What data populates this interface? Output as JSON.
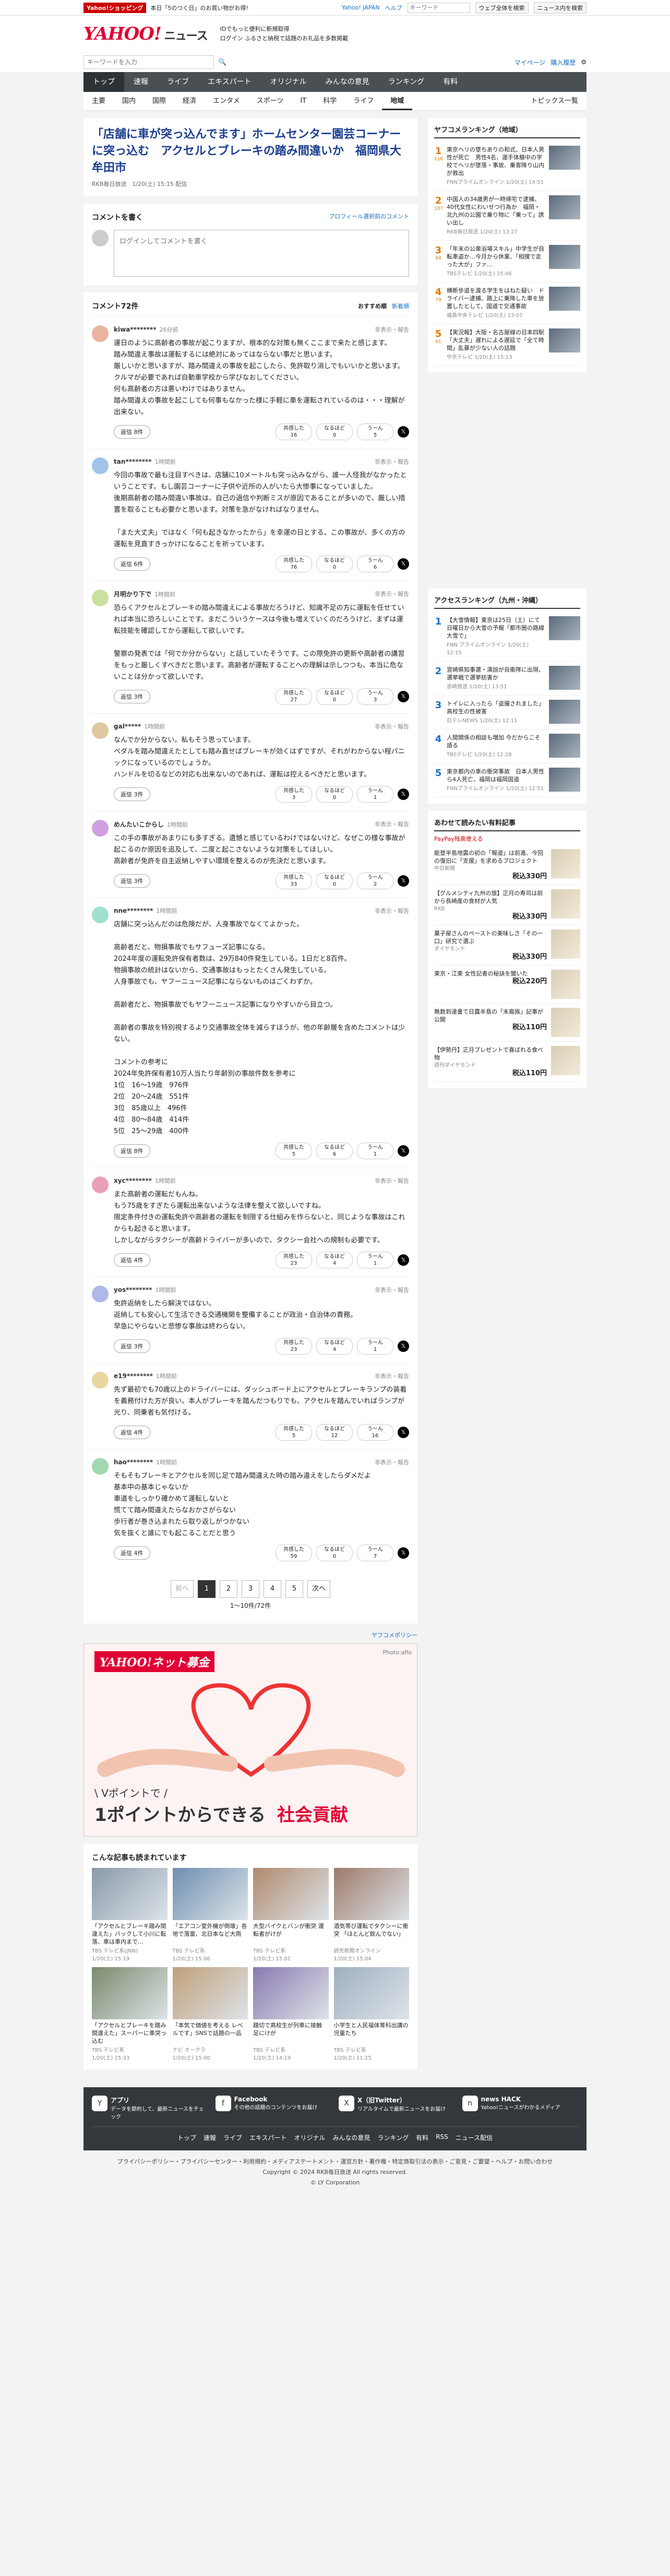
{
  "promo": {
    "tag": "Yahoo!ショッピング",
    "text": "本日「5のつく日」のお買い物がお得!",
    "link1": "Yahoo! JAPAN",
    "link2": "ヘルプ",
    "search_placeholder": "キーワード",
    "search_btn": "ウェブ全体を検索",
    "search_btn2": "ニュース内を検索"
  },
  "masthead": {
    "logo": "YAHOO!",
    "logo_sub": "ニュース",
    "msg1": "IDでもっと便利に新規取得",
    "msg2": "ログイン ふるさと納税で話題のお礼品を多数掲載"
  },
  "search": {
    "placeholder": "キーワードを入力",
    "mypage": "マイページ",
    "purchase": "購入履歴",
    "settings_icon": "gear-icon"
  },
  "nav_main": [
    "トップ",
    "速報",
    "ライブ",
    "エキスパート",
    "オリジナル",
    "みんなの意見",
    "ランキング",
    "有料"
  ],
  "nav_main_active": 0,
  "nav_sub": [
    "主要",
    "国内",
    "国際",
    "経済",
    "エンタメ",
    "スポーツ",
    "IT",
    "科学",
    "ライフ",
    "地域"
  ],
  "nav_sub_active": 9,
  "nav_sub_right": "トピックス一覧",
  "article": {
    "title": "「店舗に車が突っ込んでます」ホームセンター園芸コーナーに突っ込む　アクセルとブレーキの踏み間違いか　福岡県大牟田市",
    "source": "RKB毎日放送",
    "date": "1/20(土) 15:15 配信"
  },
  "write": {
    "title": "コメントを書く",
    "profile_link": "プロフィール選択前のコメント",
    "placeholder": "ログインしてコメントを書く"
  },
  "comments_head": {
    "title": "コメント72件",
    "sort1": "おすすめ順",
    "sort2": "新着順"
  },
  "react_labels": {
    "agree": "共感した",
    "think": "なるほど",
    "disagree": "うーん"
  },
  "comments": [
    {
      "user": "kiwa********",
      "time": "26分前",
      "report": "非表示・報告",
      "text": "運日のように高齢者の事故が起こりますが、根本的な対策も無くここまで来たと感じます。\n踏み間違え事故は運転するには絶対にあってはならない事だと思います。\n厳しいかと思いますが、踏み間違えの事故を起こしたら、免許取り消しでもいいかと思います。\nクルマが必要であれば自動車学校から学びなおしてください。\n何も高齢者の方は悪いわけではありません。\n踏み間違えの事故を起こしても何事もなかった様に手軽に車を運転されているのは・・・理解が出来ない。",
      "reply": "返信 8件",
      "agree": "16",
      "think": "0",
      "disagree": "5"
    },
    {
      "user": "tan********",
      "time": "1時間前",
      "report": "非表示・報告",
      "text": "今回の事故で最も注目すべきは、店舗に10メートルも突っ込みながら、誰一人怪我がなかったということです。もし園芸コーナーに子供や近所の人がいたら大惨事になっていました。\n後期高齢者の踏み間違い事故は、自己の過信や判断ミスが原因であることが多いので、厳しい措置を取ることも必要かと思います。対策を急がなければなりません。\n\n「また大丈夫」ではなく「何も起きなかったから」を幸運の日とする。この事故が、多くの方の運転を見直すきっかけになることを祈っています。",
      "reply": "返信 6件",
      "agree": "76",
      "think": "0",
      "disagree": "6"
    },
    {
      "user": "月明かり下で",
      "time": "1時間前",
      "report": "非表示・報告",
      "text": "恐らくアクセルとブレーキの踏み間違えによる事故だろうけど、知識不足の方に運転を任せていれば本当に恐ろしいことです。まだこういうケースは今後も増えていくのだろうけど、まずは運転技能を確認してから運転して欲しいです。\n\n警察の発表では「何でか分からない」と話していたそうです。この際免許の更新や高齢者の講習をもっと厳しくすべきだと思います。高齢者が運転することへの理解は示しつつも、本当に危ないことは分かって欲しいです。",
      "reply": "返信 3件",
      "agree": "27",
      "think": "0",
      "disagree": "3"
    },
    {
      "user": "gal*****",
      "time": "1時間前",
      "report": "非表示・報告",
      "text": "なんでか分からない。私もそう思っています。\nペダルを踏み間違えたとしても踏み直せばブレーキが効くはずですが、それがわからない程パニックになっているのでしょうか。\nハンドルを切るなどの対応も出来ないのであれば、運転は控えるべきだと思います。",
      "reply": "返信 3件",
      "agree": "3",
      "think": "0",
      "disagree": "1"
    },
    {
      "user": "めんたいこからし",
      "time": "1時間前",
      "report": "非表示・報告",
      "text": "この手の事故があまりにも多すぎる。遺憾と感じているわけではないけど、なぜこの様な事故が起こるのか原因を追及して、二度と起こさないような対策をしてほしい。\n高齢者が免許を自主返納しやすい環境を整えるのが先決だと思います。",
      "reply": "返信 3件",
      "agree": "33",
      "think": "0",
      "disagree": "2"
    },
    {
      "user": "nne********",
      "time": "1時間前",
      "report": "非表示・報告",
      "text": "店舗に突っ込んだのは危険だが、人身事故でなくてよかった。\n\n高齢者だと、物損事故でもサフューズ記事になる。\n2024年度の運転免許保有者数は、29万840件発生している。1日だと8百件。\n物損事故の統計はないから、交通事故はもっとたくさん発生している。\n人身事故でも、ヤフーニュース記事にならないものはごくわずか。\n\n高齢者だと、物損事故でもヤフーニュース記事になりやすいから目立つ。\n\n高齢者の事故を特別視するより交通事故全体を減らすほうが、他の年齢層を含めたコメントは少ない。\n\nコメントの参考に\n2024年免許保有者10万人当たり年齢別の事故件数を参考に\n1位　16〜19歳　976件\n2位　20〜24歳　551件\n3位　85歳以上　496件\n4位　80〜84歳　414件\n5位　25〜29歳　400件",
      "reply": "返信 8件",
      "agree": "5",
      "think": "6",
      "disagree": "1"
    },
    {
      "user": "xyc********",
      "time": "1時間前",
      "report": "非表示・報告",
      "text": "また高齢者の運転だもんね。\nもう75歳をすぎたら運転出来ないような法律を整えて欲しいですね。\n限定条件付きの運転免許や高齢者の運転を制限する仕組みを作らないと、同じような事故はこれからも起きると思います。\nしかしながらタクシーが高齢ドライバーが多いので、タクシー会社への規制も必要です。",
      "reply": "返信 4件",
      "agree": "23",
      "think": "4",
      "disagree": "1"
    },
    {
      "user": "yos********",
      "time": "1時間前",
      "report": "非表示・報告",
      "text": "免許返納をしたら解決ではない。\n返納しても安心して生活できる交通機関を整備することが政治・自治体の責務。\n早急にやらないと悲惨な事故は終わらない。",
      "reply": "返信 3件",
      "agree": "23",
      "think": "4",
      "disagree": "1"
    },
    {
      "user": "e19********",
      "time": "1時間前",
      "report": "非表示・報告",
      "text": "先ず最初でも70歳以上のドライバーには、ダッシュボード上にアクセルとブレーキランプの装着を義務付けた方が良い。本人がブレーキを踏んだつもりでも、アクセルを踏んでいればランプが光り、同乗者も気付ける。",
      "reply": "返信 4件",
      "agree": "5",
      "think": "12",
      "disagree": "16"
    },
    {
      "user": "hao********",
      "time": "1時間前",
      "report": "非表示・報告",
      "text": "そもそもブレーキとアクセルを同じ足で踏み間違えた時の踏み違えをしたらダメだよ\n基本中の基本じゃないか\n車道をしっかり確かめて運転しないと\n慌てて踏み間違えたらなおかさがらない\n歩行者が巻き込まれたら取り返しがつかない\n気を抜くと誰にでも起こることだと思う",
      "reply": "返信 4件",
      "agree": "59",
      "think": "0",
      "disagree": "7"
    }
  ],
  "pager": {
    "prev": "前へ",
    "pages": [
      "1",
      "2",
      "3",
      "4",
      "5"
    ],
    "current": 0,
    "next": "次へ",
    "info": "1〜10件/72件"
  },
  "ad": {
    "link": "ヤフコメポリシー",
    "logo": "YAHOO!ネット募金",
    "corner": "Photo:aflo",
    "line1": "\\ Vポイントで /",
    "line2": "1ポイントからできる",
    "line3": "社会貢献"
  },
  "recommend": {
    "title": "こんな記事も読まれています",
    "items": [
      {
        "title": "「アクセルとブレーキ踏み間違えた」バックして小川に転落、車は車内まで…",
        "src": "TBS テレビ系(JNN)",
        "date": "1/20(土) 15:19"
      },
      {
        "title": "「エアコン室外機が倒壊」各地で落雷、北日本など大雨",
        "src": "TBS テレビ系",
        "date": "1/20(土) 15:06"
      },
      {
        "title": "大型バイクとバンが衝突 運転者がけが",
        "src": "TBS テレビ系",
        "date": "1/20(土) 15:01"
      },
      {
        "title": "酒気帯び運転でタクシーに衝突 「ほとんど飲んでない」",
        "src": "読売新聞オンライン",
        "date": "1/20(土) 15:04"
      },
      {
        "title": "「アクセルとブレーキを踏み間違えた」スーパーに車突っ込む",
        "src": "TBS テレビ系",
        "date": "1/20(土) 15:33"
      },
      {
        "title": "「本気で価値を考える レベルです」SNSで話題の一品",
        "src": "ナビ オークラ",
        "date": "1/20(土) 15:00"
      },
      {
        "title": "踏切で高校生が列車に接触 足にけが",
        "src": "TBS テレビ系",
        "date": "1/20(土) 14:19"
      },
      {
        "title": "小学生と人民福体育科出講の児童たち",
        "src": "TBS テレビ系",
        "date": "1/20(土) 11:25"
      }
    ]
  },
  "ranking": {
    "title": "ヤフコメランキング（地域）",
    "items": [
      {
        "num": "1",
        "count": "116",
        "text": "東京ヘリの墜ちありの和式、日本人男性が死亡　男性4名、運手体験中の学校でヘリが墜落・事故、乗客降り山内が救出",
        "src": "FNNプライムオンライン",
        "date": "1/20(土) 14:51"
      },
      {
        "num": "2",
        "count": "107",
        "text": "中国人の34歳男が一時帰宅で逮捕、40代女性にわいせつ行為か　福岡・北九州の公園で乗り物に「乗って」誘い出し",
        "src": "RKB毎日放送",
        "date": "1/20(土) 13:27"
      },
      {
        "num": "3",
        "count": "94",
        "text": "「年末の公衆浴場スキル」中学生が自転車盗か…今月から休業、「相撲で走った大が」ファ…",
        "src": "TBSテレビ",
        "date": "1/20(土) 15:46"
      },
      {
        "num": "4",
        "count": "79",
        "text": "横断歩道を渡る学生をはねた疑い　ドライバー逮捕、路上に乗降した車を放置したとして、国道で交通事故",
        "src": "福島中央テレビ",
        "date": "1/20(土) 13:07"
      },
      {
        "num": "5",
        "count": "61",
        "text": "【実況報】大阪・名古屋線の日本四駅「大丈夫」遅れによる遅延で「全て時間」乱暴が少ない人の話題",
        "src": "中京テレビ",
        "date": "1/20(土) 15:13"
      }
    ]
  },
  "access": {
    "title": "アクセスランキング（九州・沖縄）",
    "items": [
      {
        "num": "1",
        "text": "【大雪情報】東京は25日（土）にて日曜日から大雪の予報「都市圏の路線大雪で」",
        "src": "FNN プライムオンライン",
        "date": "1/20(土) 12:15"
      },
      {
        "num": "2",
        "text": "宮崎県知事選・演説が自衛隊に出現、選挙戦で選挙妨害か",
        "src": "宮崎放送",
        "date": "1/20(土) 13:51"
      },
      {
        "num": "3",
        "text": "トイレに入ったら「盗撮されました」高校生の性被害",
        "src": "日テレNEWS",
        "date": "1/20(土) 12:11"
      },
      {
        "num": "4",
        "text": "人間関係の相談も増加 今だからこそ語る",
        "src": "TBSテレビ",
        "date": "1/20(土) 12:28"
      },
      {
        "num": "5",
        "text": "東京都内の車の衝突事故　日本人男性ら4人死亡、福岡は福岡国道",
        "src": "FNNプライムオンライン",
        "date": "1/20(土) 12:51"
      }
    ]
  },
  "shop": {
    "title": "あわせて読みたい有料記事",
    "subtitle": "PayPay残高使える",
    "items": [
      {
        "text": "能登半島地震の初の「報道」は前進、今回の復旧に「支援」を求めるプロジェクト",
        "src": "中日新聞",
        "price": "税込330円"
      },
      {
        "text": "【グルメシティ九州の旅】正月の寿司は前から長崎産の食材が人気",
        "src": "RKB",
        "price": "税込330円"
      },
      {
        "text": "菓子屋さんのペーストの美味しさ「その一口」研究で選ぶ",
        "src": "ダイヤモンド",
        "price": "税込330円"
      },
      {
        "text": "東京・江東 女性記者の秘訣を聞いた",
        "src": "",
        "price": "税込220円"
      },
      {
        "text": "無数到達書て日露半島の「末裔族」記事が公開",
        "src": "",
        "price": "税込110円"
      },
      {
        "text": "【伊勢丹】正月プレゼントで喜ばれる食べ物",
        "src": "週刊ダイヤモンド",
        "price": "税込110円"
      }
    ]
  },
  "footer": {
    "apps": [
      {
        "title": "アプリ",
        "text": "データを節約して、最新ニュースをチェック",
        "icon": "Y"
      },
      {
        "title": "Facebook",
        "text": "その他の話題のコンテンツをお届け",
        "icon": "f"
      },
      {
        "title": "X（旧Twitter）",
        "text": "リアルタイムで最新ニュースをお届け",
        "icon": "X"
      },
      {
        "title": "news HACK",
        "text": "Yahoo!ニュースがわかるメディア",
        "icon": "n"
      }
    ],
    "nav": [
      "トップ",
      "速報",
      "ライブ",
      "エキスパート",
      "オリジナル",
      "みんなの意見",
      "ランキング",
      "有料",
      "RSS",
      "ニュース配信"
    ],
    "legal1": "プライバシーポリシー・プライバシーセンター・利用規約・メディアステートメント・運営方針・著作権・特定商取引法の表示・ご意見・ご要望・ヘルプ・お問い合わせ",
    "legal2": "Copyright © 2024 RKB毎日放送 All rights reserved.",
    "legal3": "© LY Corporation"
  },
  "colors": {
    "accent": "#e00033",
    "title": "#1a3d8f",
    "nav_bg": "#4a4f54"
  }
}
